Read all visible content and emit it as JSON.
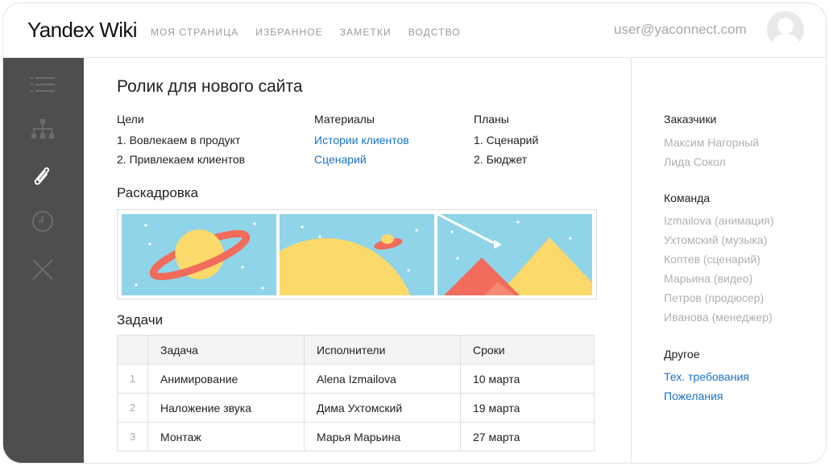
{
  "header": {
    "logo_brand": "Yandex",
    "logo_product": "Wiki",
    "nav": [
      "МОЯ СТРАНИЦА",
      "ИЗБРАННОЕ",
      "ЗАМЕТКИ",
      "ВОДСТВО"
    ],
    "user_email": "user@yaconnect.com"
  },
  "sidebar": {
    "icons": [
      "list-icon",
      "sitemap-icon",
      "paperclip-icon",
      "clock-icon",
      "close-icon"
    ]
  },
  "page": {
    "title": "Ролик для нового сайта",
    "goals": {
      "heading": "Цели",
      "items": [
        "1. Вовлекаем в продукт",
        "2. Привлекаем клиентов"
      ]
    },
    "materials": {
      "heading": "Материалы",
      "items": [
        "Истории клиентов",
        "Сценарий"
      ]
    },
    "plans": {
      "heading": "Планы",
      "items": [
        "1. Сценарий",
        "2. Бюджет"
      ]
    },
    "storyboard_heading": "Раскадровка",
    "tasks_heading": "Задачи",
    "tasks_table": {
      "columns": [
        "Задача",
        "Исполнители",
        "Сроки"
      ],
      "rows": [
        {
          "num": "1",
          "task": "Анимирование",
          "assignee": "Alena Izmailova",
          "due": "10 марта"
        },
        {
          "num": "2",
          "task": "Наложение звука",
          "assignee": "Дима Ухтомский",
          "due": "19 марта"
        },
        {
          "num": "3",
          "task": "Монтаж",
          "assignee": "Марья Марьина",
          "due": "27 марта"
        }
      ]
    }
  },
  "right_panel": {
    "customers_heading": "Заказчики",
    "customers": [
      "Максим Нагорный",
      "Лида Сокол"
    ],
    "team_heading": "Команда",
    "team": [
      "Izmailova (анимация)",
      "Ухтомский (музыка)",
      "Коптев (сценарий)",
      "Марьина (видео)",
      "Петров (продюсер)",
      "Иванова (менеджер)"
    ],
    "other_heading": "Другое",
    "other_links": [
      "Тех. требования",
      "Пожелания"
    ]
  },
  "colors": {
    "sidebar_bg": "#4e4e4e",
    "link": "#1a73c8",
    "sky": "#8fd4e8",
    "sun_yellow": "#fbd96b",
    "coral": "#f26b5b"
  }
}
